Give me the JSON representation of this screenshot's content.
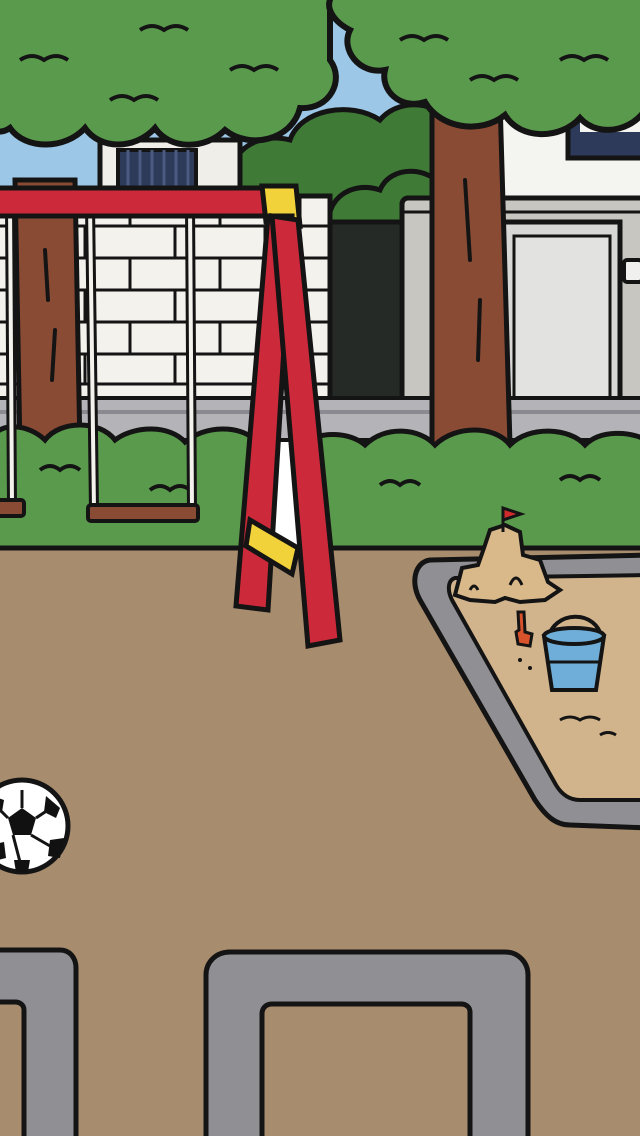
{
  "scene": {
    "name": "playground",
    "colors": {
      "sky": "#9cc7e6",
      "outline": "#141414",
      "tree_leaves": "#5a9a4c",
      "tree_leaves_dark": "#3f7a36",
      "tree_trunk": "#8a4b35",
      "bush": "#5a9a4c",
      "ground": "#a88c6e",
      "path_curb": "#8f8f94",
      "sand": "#d2b48c",
      "swing_frame_red": "#cc2a3a",
      "swing_frame_yellow": "#f2d23a",
      "swing_seat": "#8a4b35",
      "wall_brick": "#f4f2ec",
      "wall_grey": "#c8c6c0",
      "building_white": "#f4f4f0",
      "fence_dark": "#252a27",
      "bucket_blue": "#6eaed8",
      "shovel_red": "#d8522c",
      "flag_red": "#d02c2c",
      "ball_white": "#ffffff",
      "ball_black": "#111111"
    },
    "icons": {
      "soccer_ball": "soccer-ball-icon",
      "sand_bucket": "sand-bucket-icon",
      "toy_shovel": "toy-shovel-icon",
      "sand_castle": "sand-castle-icon",
      "castle_flag": "flag-icon"
    }
  }
}
